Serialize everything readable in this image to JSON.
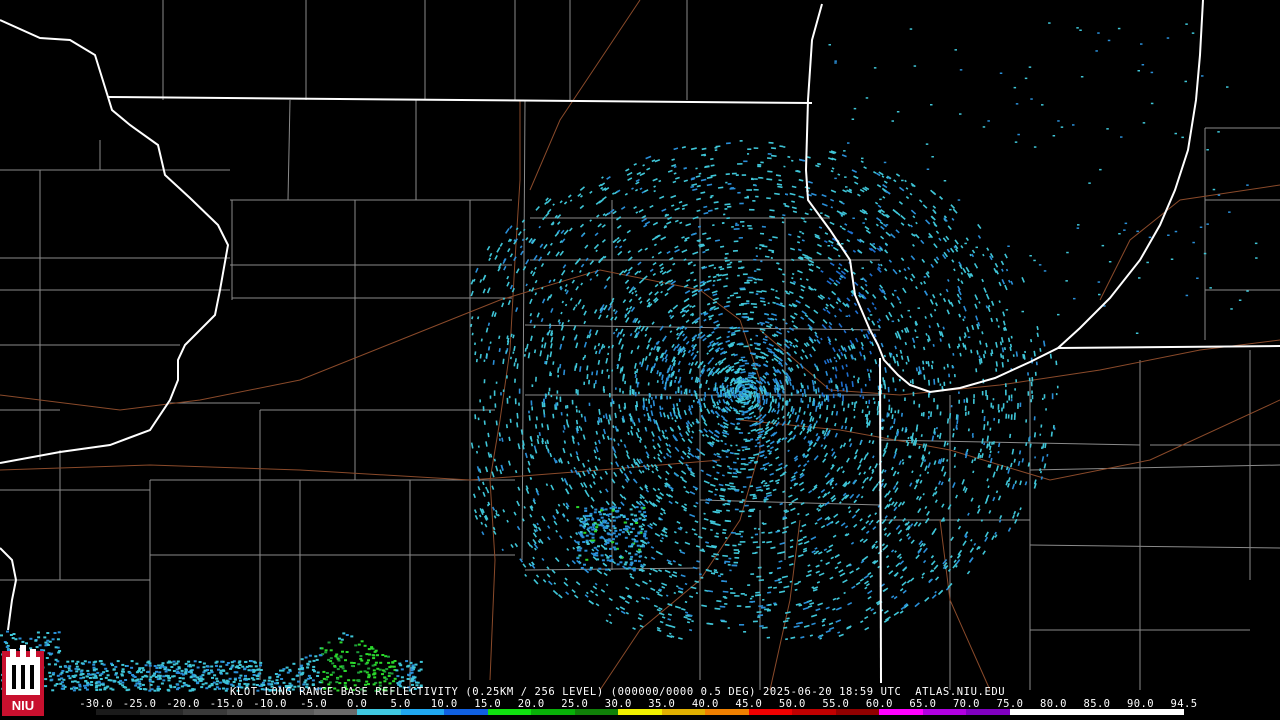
{
  "product": {
    "caption": "KLOT LONG RANGE BASE REFLECTIVITY (0.25KM / 256 LEVEL) (000000/0000 0.5 DEG) 2025-06-20 18:59 UTC  ATLAS.NIU.EDU"
  },
  "colorbar": {
    "ticks": [
      "-30.0",
      "-25.0",
      "-20.0",
      "-15.0",
      "-10.0",
      "-5.0",
      "0.0",
      "5.0",
      "10.0",
      "15.0",
      "20.0",
      "25.0",
      "30.0",
      "35.0",
      "40.0",
      "45.0",
      "50.0",
      "55.0",
      "60.0",
      "65.0",
      "70.0",
      "75.0",
      "80.0",
      "85.0",
      "90.0",
      "94.5"
    ],
    "colors": [
      "#1a1a1a",
      "#2a2a2a",
      "#3a3a3a",
      "#4a4a4a",
      "#5a5a5a",
      "#6a6a6a",
      "#40c8e0",
      "#20a8f0",
      "#1060e0",
      "#10e010",
      "#08b008",
      "#108008",
      "#f0f000",
      "#e0b000",
      "#f08000",
      "#f00000",
      "#c00000",
      "#900000",
      "#ff00ff",
      "#b000e0",
      "#8000c0",
      "#ffffff",
      "#ffffff",
      "#ffffff",
      "#ffffff"
    ]
  },
  "logo": {
    "text": "NIU",
    "color": "#c8102e"
  },
  "colors": {
    "state_border": "#ffffff",
    "county_border": "#8a8a8a",
    "road": "#8a4a2a",
    "echo_light": "#3fc6d8",
    "echo_mid": "#2a8fd8",
    "echo_heavy": "#2bd92b"
  }
}
